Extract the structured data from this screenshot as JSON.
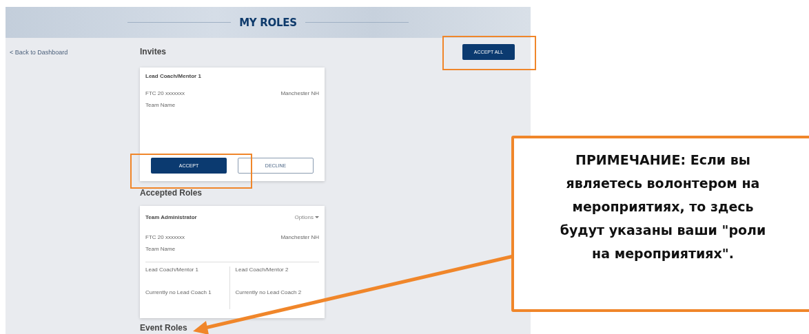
{
  "header": {
    "title": "MY ROLES"
  },
  "back_link": "< Back to Dashboard",
  "invites": {
    "heading": "Invites",
    "accept_all": "ACCEPT ALL",
    "cards": [
      {
        "role": "Lead Coach/Mentor 1",
        "team_number": "FTC 20 xxxxxxx",
        "location": "Manchester NH",
        "team_name": "Team Name",
        "accept": "ACCEPT",
        "decline": "DECLINE"
      }
    ]
  },
  "accepted_roles": {
    "heading": "Accepted Roles",
    "cards": [
      {
        "role": "Team Administrator",
        "options": "Options",
        "team_number": "FTC 20 xxxxxxx",
        "location": "Manchester NH",
        "team_name": "Team Name",
        "coaches": [
          {
            "title": "Lead Coach/Mentor 1",
            "status": "Currently no Lead Coach 1"
          },
          {
            "title": "Lead Coach/Mentor 2",
            "status": "Currently no Lead Coach 2"
          }
        ]
      }
    ]
  },
  "event_roles": {
    "heading": "Event Roles"
  },
  "annotation": {
    "note": "ПРИМЕЧАНИЕ: Если вы являетесь волонтером на мероприятиях, то здесь будут указаны ваши \"роли на мероприятиях\"."
  }
}
